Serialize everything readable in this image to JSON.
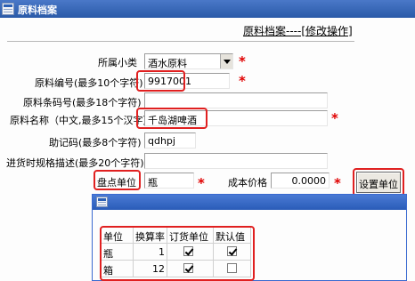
{
  "window": {
    "title": "原料档案"
  },
  "form_header": "原料档案----[修改操作]",
  "fields": {
    "subcategory": {
      "label": "所属小类",
      "value": "酒水原料"
    },
    "code": {
      "label": "原料编号(最多10个字符)",
      "value": "9917001"
    },
    "barcode": {
      "label": "原料条码号(最多18个字符)",
      "value": ""
    },
    "name": {
      "label": "原料名称（中文,最多15个汉字）",
      "value": "千岛湖啤酒"
    },
    "mnemonic": {
      "label": "助记码(最多8个字符)",
      "value": "qdhpj"
    },
    "spec": {
      "label": "进货时规格描述(最多20个字符)",
      "value": ""
    },
    "stock_unit": {
      "label": "盘点单位",
      "value": "瓶"
    },
    "cost_price": {
      "label": "成本价格",
      "value": "0.0000"
    }
  },
  "required_mark": "*",
  "buttons": {
    "set_unit": "设置单位"
  },
  "unit_table": {
    "headers": [
      "单位",
      "换算率",
      "订货单位",
      "默认值"
    ],
    "rows": [
      {
        "unit": "瓶",
        "rate": "1",
        "order_unit": true,
        "default": true
      },
      {
        "unit": "箱",
        "rate": "12",
        "order_unit": true,
        "default": false
      }
    ]
  }
}
